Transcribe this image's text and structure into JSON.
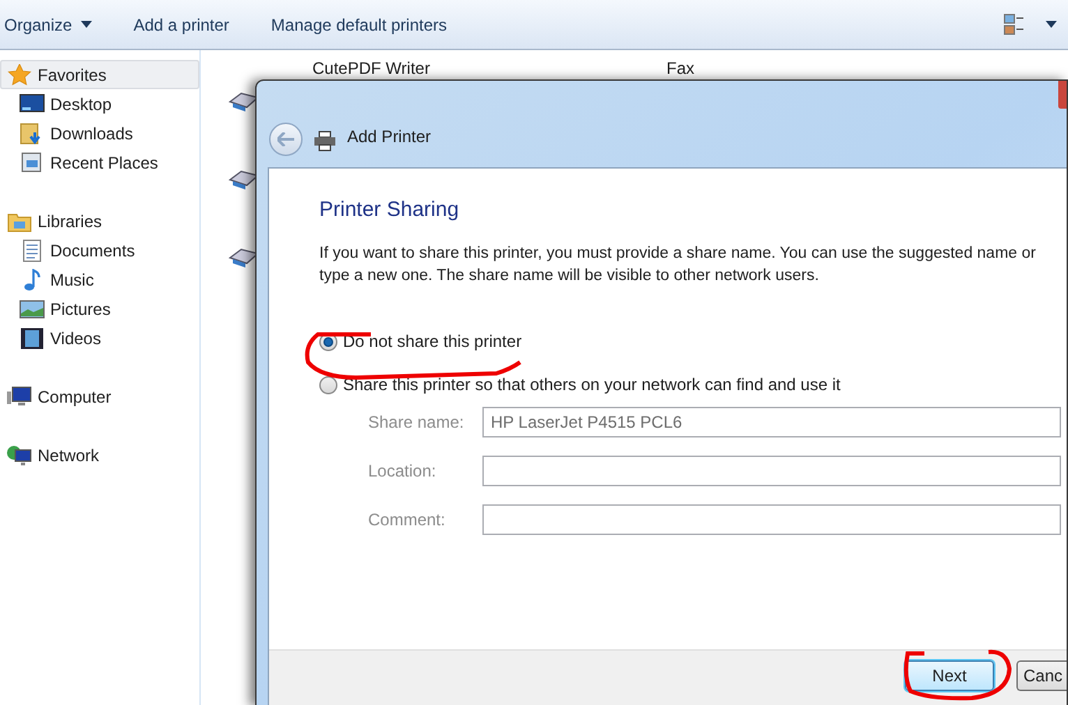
{
  "toolbar": {
    "items": [
      {
        "label": "Organize",
        "kind": "menu"
      },
      {
        "label": "Add a printer",
        "kind": "button"
      },
      {
        "label": "Manage default printers",
        "kind": "button"
      }
    ]
  },
  "sidebar": {
    "groups": [
      {
        "label": "Favorites",
        "selected": true,
        "children": [
          {
            "label": "Desktop",
            "selected": false
          },
          {
            "label": "Downloads",
            "selected": false
          },
          {
            "label": "Recent Places",
            "selected": false
          }
        ]
      },
      {
        "label": "Libraries",
        "selected": false,
        "children": [
          {
            "label": "Documents",
            "selected": false
          },
          {
            "label": "Music",
            "selected": false
          },
          {
            "label": "Pictures",
            "selected": false
          },
          {
            "label": "Videos",
            "selected": false
          }
        ]
      },
      {
        "label": "Computer",
        "selected": false
      },
      {
        "label": "Network",
        "selected": false
      }
    ]
  },
  "devices": [
    {
      "name": "CutePDF Writer"
    },
    {
      "name": "Fax"
    }
  ],
  "dialog": {
    "title": "Add Printer",
    "heading": "Printer Sharing",
    "description": "If you want to share this printer, you must provide a share name. You can use the suggested name or type a new one. The share name will be visible to other network users.",
    "options": [
      {
        "label": "Do not share this printer",
        "selected": true
      },
      {
        "label": "Share this printer so that others on your network can find and use it",
        "selected": false
      }
    ],
    "fields": [
      {
        "label": "Share name:",
        "value": "HP LaserJet P4515 PCL6",
        "disabled": true
      },
      {
        "label": "Location:",
        "disabled": true
      },
      {
        "label": "Comment:",
        "disabled": true
      }
    ],
    "buttons": [
      {
        "label": "Next",
        "kind": "default"
      },
      {
        "label": "Canc",
        "kind": "normal"
      }
    ]
  }
}
